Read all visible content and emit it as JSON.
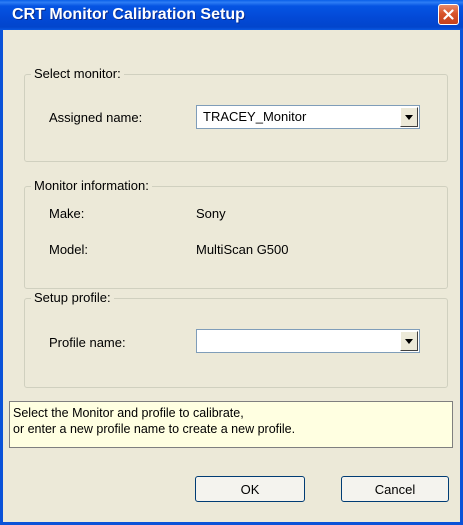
{
  "window": {
    "title": "CRT Monitor Calibration Setup"
  },
  "select_monitor": {
    "title": "Select monitor:",
    "assigned_name_label": "Assigned name:",
    "assigned_name_value": "TRACEY_Monitor"
  },
  "monitor_info": {
    "title": "Monitor information:",
    "make_label": "Make:",
    "make_value": "Sony",
    "model_label": "Model:",
    "model_value": "MultiScan G500"
  },
  "setup_profile": {
    "title": "Setup profile:",
    "profile_name_label": "Profile name:",
    "profile_name_value": ""
  },
  "hint": {
    "line1": "Select the Monitor and profile to calibrate,",
    "line2": "or enter a new profile name to create a new profile."
  },
  "buttons": {
    "ok": "OK",
    "cancel": "Cancel"
  },
  "icons": {
    "close": "close-icon",
    "dropdown": "chevron-down-icon"
  },
  "colors": {
    "titlebar": "#0a52d8",
    "close": "#d8542a",
    "face": "#ece9d8",
    "hint_bg": "#ffffe1"
  }
}
